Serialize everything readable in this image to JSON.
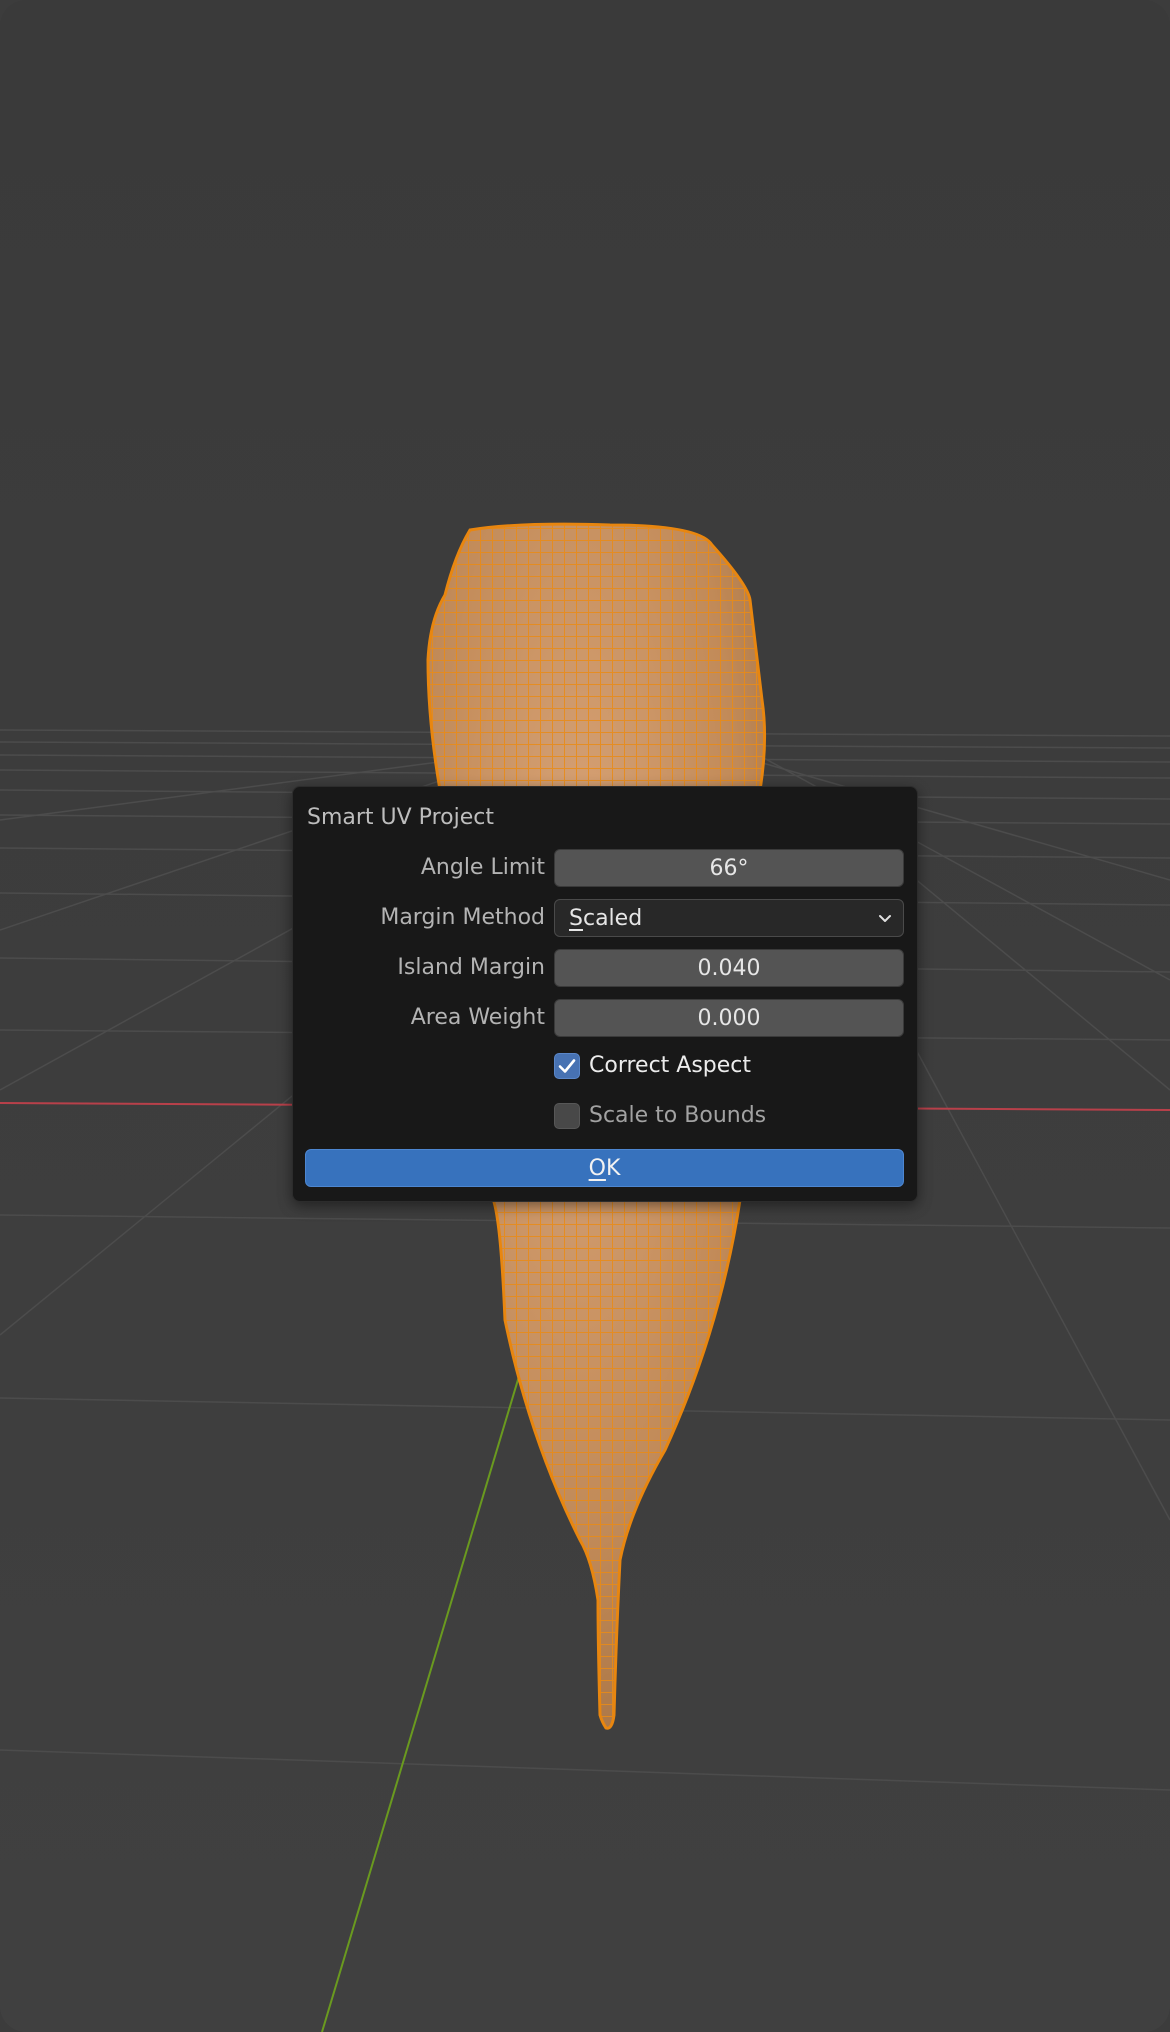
{
  "dialog": {
    "title": "Smart UV Project",
    "fields": [
      {
        "label": "Angle Limit",
        "value": "66°"
      },
      {
        "label": "Margin Method",
        "value_first": "S",
        "value_rest": "caled"
      },
      {
        "label": "Island Margin",
        "value": "0.040"
      },
      {
        "label": "Area Weight",
        "value": "0.000"
      }
    ],
    "checkboxes": [
      {
        "label": "Correct Aspect",
        "checked": true
      },
      {
        "label": "Scale to Bounds",
        "checked": false
      }
    ],
    "ok": {
      "first": "O",
      "rest": "K"
    }
  },
  "colors": {
    "viewport_bg": "#3d3d3d",
    "mesh_fill": "#c9935f",
    "mesh_wire": "#e88a14",
    "x_axis": "#b8404a",
    "y_axis": "#6a9a1f",
    "accent": "#3772bd"
  },
  "icons": {
    "dropdown": "chevron-down-icon",
    "check": "checkmark-icon"
  }
}
